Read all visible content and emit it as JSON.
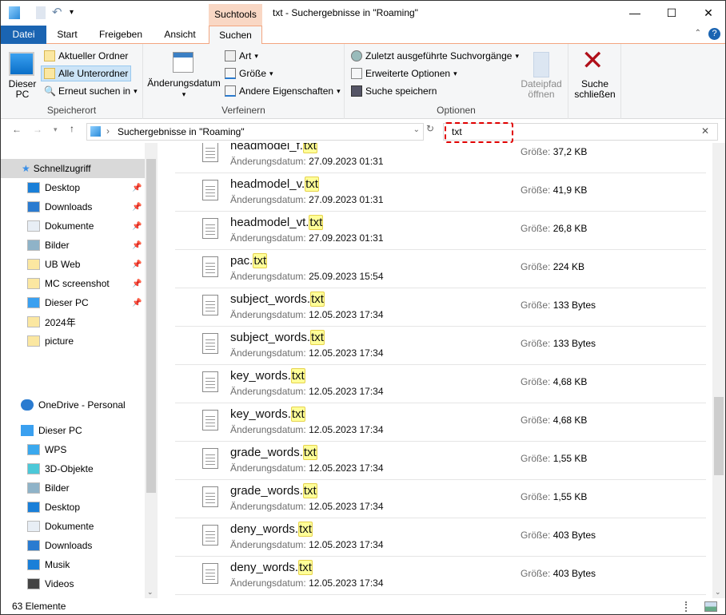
{
  "window": {
    "title": "txt - Suchergebnisse in \"Roaming\"",
    "context_tab": "Suchtools"
  },
  "tabs": [
    "Datei",
    "Start",
    "Freigeben",
    "Ansicht",
    "Suchen"
  ],
  "ribbon": {
    "speicherort": {
      "label": "Speicherort",
      "dieser_pc": "Dieser PC",
      "aktueller": "Aktueller Ordner",
      "alle": "Alle Unterordner",
      "erneut": "Erneut suchen in"
    },
    "verfeinern": {
      "label": "Verfeinern",
      "datum": "Änderungsdatum",
      "art": "Art",
      "groesse": "Größe",
      "andere": "Andere Eigenschaften"
    },
    "optionen": {
      "label": "Optionen",
      "zuletzt": "Zuletzt ausgeführte Suchvorgänge",
      "erweitert": "Erweiterte Optionen",
      "speichern": "Suche speichern",
      "dateipfad": "Dateipfad öffnen"
    },
    "schliessen": "Suche schließen"
  },
  "address": {
    "path": "Suchergebnisse in \"Roaming\"",
    "search": "txt"
  },
  "sidebar": {
    "quick": "Schnellzugriff",
    "quick_items": [
      "Desktop",
      "Downloads",
      "Dokumente",
      "Bilder",
      "UB Web",
      "MC screenshot",
      "Dieser PC",
      "2024年",
      "picture"
    ],
    "onedrive": "OneDrive - Personal",
    "pc": "Dieser PC",
    "pc_items": [
      "WPS",
      "3D-Objekte",
      "Bilder",
      "Desktop",
      "Dokumente",
      "Downloads",
      "Musik",
      "Videos"
    ]
  },
  "labels": {
    "date": "Änderungsdatum:",
    "size": "Größe:",
    "ext": "txt"
  },
  "files": [
    {
      "name": "headmodel_f.",
      "date": "27.09.2023 01:31",
      "size": "37,2 KB"
    },
    {
      "name": "headmodel_v.",
      "date": "27.09.2023 01:31",
      "size": "41,9 KB"
    },
    {
      "name": "headmodel_vt.",
      "date": "27.09.2023 01:31",
      "size": "26,8 KB"
    },
    {
      "name": "pac.",
      "date": "25.09.2023 15:54",
      "size": "224 KB"
    },
    {
      "name": "subject_words.",
      "date": "12.05.2023 17:34",
      "size": "133 Bytes"
    },
    {
      "name": "subject_words.",
      "date": "12.05.2023 17:34",
      "size": "133 Bytes"
    },
    {
      "name": "key_words.",
      "date": "12.05.2023 17:34",
      "size": "4,68 KB"
    },
    {
      "name": "key_words.",
      "date": "12.05.2023 17:34",
      "size": "4,68 KB"
    },
    {
      "name": "grade_words.",
      "date": "12.05.2023 17:34",
      "size": "1,55 KB"
    },
    {
      "name": "grade_words.",
      "date": "12.05.2023 17:34",
      "size": "1,55 KB"
    },
    {
      "name": "deny_words.",
      "date": "12.05.2023 17:34",
      "size": "403 Bytes"
    },
    {
      "name": "deny_words.",
      "date": "12.05.2023 17:34",
      "size": "403 Bytes"
    }
  ],
  "status": {
    "count": "63 Elemente"
  },
  "colors": {
    "accent": "#1a64b2",
    "context": "#f9d7c4",
    "highlight": "#ffff98",
    "search_marker": "#e00000"
  }
}
